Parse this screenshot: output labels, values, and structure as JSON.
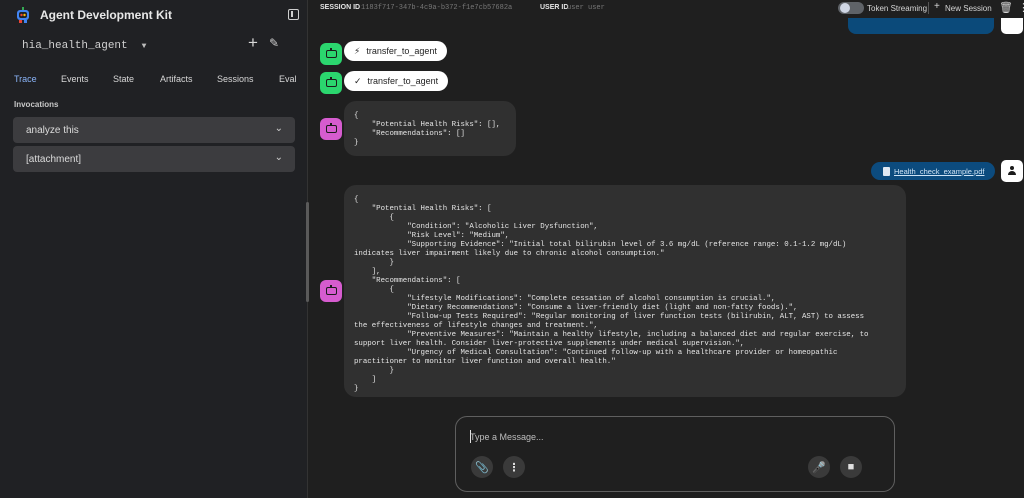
{
  "sidebar": {
    "app_title": "Agent Development Kit",
    "agent_name": "hia_health_agent",
    "tabs": [
      {
        "label": "Trace",
        "active": true
      },
      {
        "label": "Events"
      },
      {
        "label": "State"
      },
      {
        "label": "Artifacts"
      },
      {
        "label": "Sessions"
      },
      {
        "label": "Eval"
      }
    ],
    "invocations_label": "Invocations",
    "invocations": [
      {
        "label": "analyze this"
      },
      {
        "label": "[attachment]"
      }
    ]
  },
  "topbar": {
    "session_id_label": "SESSION ID",
    "session_id_value": "1183f717-347b-4c9a-b372-f1e7cb57682a",
    "user_id_label": "USER ID",
    "user_id_value": "user user",
    "token_streaming_label": "Token Streaming",
    "token_streaming_on": false,
    "new_session_label": "New Session"
  },
  "chat": {
    "function_calls": [
      {
        "label": "transfer_to_agent",
        "icon": "bolt-icon"
      },
      {
        "label": "transfer_to_agent",
        "icon": "check-icon"
      }
    ],
    "first_response": "{\n    \"Potential Health Risks\": [],\n    \"Recommendations\": []\n}",
    "attachment_name": "Health_check_example.pdf",
    "second_response": "{\n    \"Potential Health Risks\": [\n        {\n            \"Condition\": \"Alcoholic Liver Dysfunction\",\n            \"Risk Level\": \"Medium\",\n            \"Supporting Evidence\": \"Initial total bilirubin level of 3.6 mg/dL (reference range: 0.1-1.2 mg/dL)\nindicates liver impairment likely due to chronic alcohol consumption.\"\n        }\n    ],\n    \"Recommendations\": [\n        {\n            \"Lifestyle Modifications\": \"Complete cessation of alcohol consumption is crucial.\",\n            \"Dietary Recommendations\": \"Consume a liver-friendly diet (light and non-fatty foods).\",\n            \"Follow-up Tests Required\": \"Regular monitoring of liver function tests (bilirubin, ALT, AST) to assess\nthe effectiveness of lifestyle changes and treatment.\",\n            \"Preventive Measures\": \"Maintain a healthy lifestyle, including a balanced diet and regular exercise, to\nsupport liver health. Consider liver-protective supplements under medical supervision.\",\n            \"Urgency of Medical Consultation\": \"Continued follow-up with a healthcare provider or homeopathic\npractitioner to monitor liver function and overall health.\"\n        }\n    ]\n}"
  },
  "composer": {
    "placeholder": "Type a Message..."
  },
  "colors": {
    "agent_green": "#2bd66e",
    "agent_pink": "#d65ccf",
    "accent_blue": "#8ab4f8",
    "attachment_bg": "#0c4b7e"
  }
}
